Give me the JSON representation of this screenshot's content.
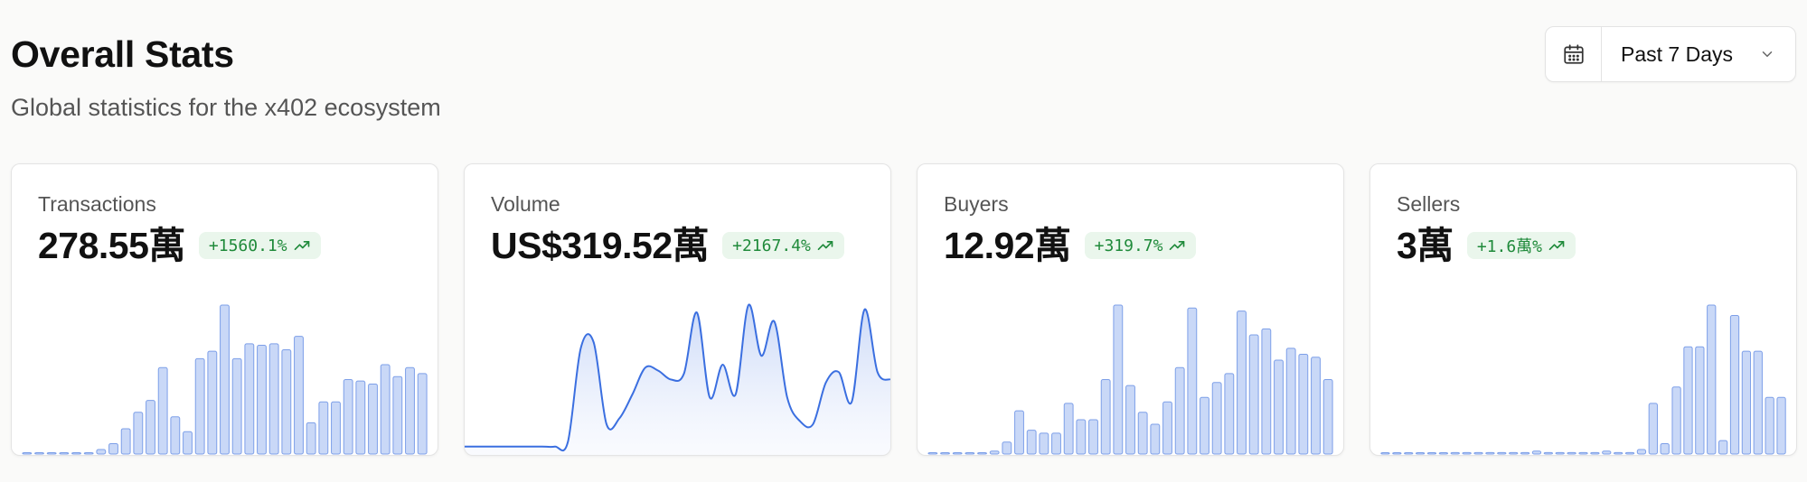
{
  "header": {
    "title": "Overall Stats",
    "subtitle": "Global statistics for the x402 ecosystem"
  },
  "range_picker": {
    "icon": "calendar-icon",
    "label": "Past 7 Days"
  },
  "colors": {
    "accent": "#3b6fe0",
    "bar_fill": "#c9d8f7",
    "badge_bg": "#eaf6ec",
    "badge_text": "#1f8a3a"
  },
  "stats": [
    {
      "label": "Transactions",
      "value": "278.55萬",
      "change": "+1560.1%",
      "chart_data": {
        "type": "bar",
        "values": [
          0,
          0,
          0,
          0,
          0,
          0.5,
          3,
          7,
          17,
          28,
          36,
          58,
          25,
          15,
          64,
          69,
          100,
          64,
          74,
          73,
          74,
          70,
          79,
          21,
          35,
          35,
          50,
          49,
          47,
          60,
          52,
          58,
          54
        ]
      }
    },
    {
      "label": "Volume",
      "value": "US$319.52萬",
      "change": "+2167.4%",
      "chart_data": {
        "type": "area",
        "values": [
          5,
          5,
          5,
          5,
          5,
          5,
          5,
          5,
          8,
          71,
          75,
          20,
          24,
          40,
          58,
          56,
          50,
          54,
          95,
          38,
          60,
          40,
          100,
          66,
          89,
          38,
          22,
          20,
          48,
          55,
          35,
          97,
          55,
          50
        ]
      }
    },
    {
      "label": "Buyers",
      "value": "12.92萬",
      "change": "+319.7%",
      "chart_data": {
        "type": "bar",
        "values": [
          0,
          0,
          0,
          0,
          0,
          2,
          8,
          29,
          16,
          14,
          14,
          34,
          23,
          23,
          50,
          100,
          46,
          28,
          20,
          35,
          58,
          98,
          38,
          48,
          54,
          96,
          80,
          84,
          63,
          71,
          67,
          65,
          50
        ]
      }
    },
    {
      "label": "Sellers",
      "value": "3萬",
      "change": "+1.6萬%",
      "chart_data": {
        "type": "bar",
        "values": [
          0,
          0,
          0,
          0,
          0,
          0,
          1,
          1,
          1,
          1,
          1,
          1,
          1,
          2,
          1,
          1,
          1,
          1,
          1,
          2,
          1,
          1,
          3,
          34,
          7,
          45,
          72,
          72,
          100,
          9,
          93,
          69,
          69,
          38,
          38
        ]
      }
    }
  ]
}
